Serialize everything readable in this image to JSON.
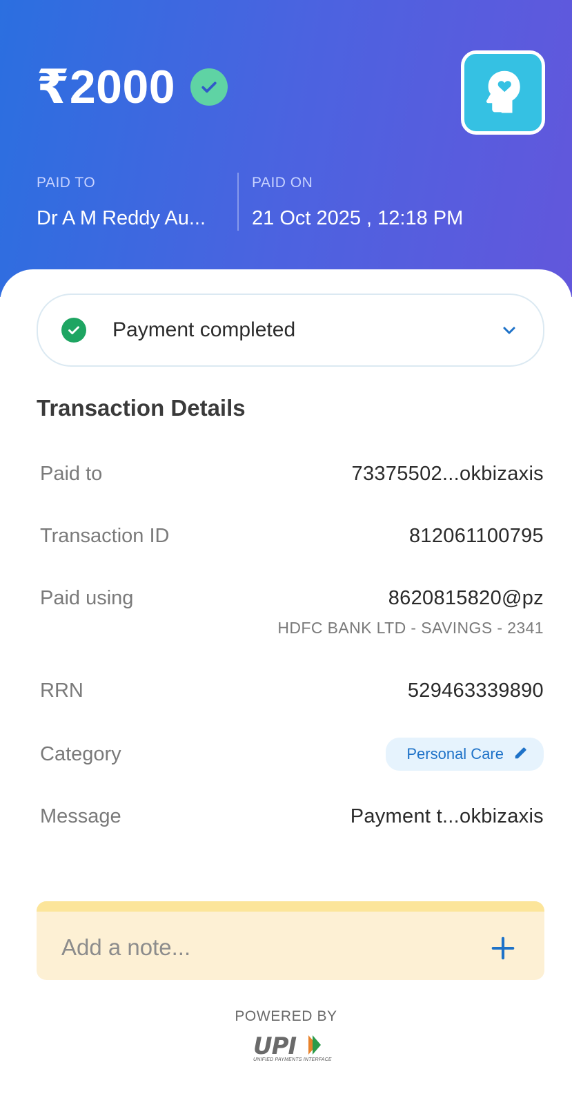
{
  "header": {
    "amount": "₹2000",
    "paid_to_label": "PAID TO",
    "paid_to_value": "Dr A M Reddy Au...",
    "paid_on_label": "PAID ON",
    "paid_on_value": "21 Oct 2025 , 12:18 PM"
  },
  "status": {
    "text": "Payment completed"
  },
  "transaction": {
    "title": "Transaction Details",
    "rows": [
      {
        "label": "Paid to",
        "value": "73375502...okbizaxis"
      },
      {
        "label": "Transaction ID",
        "value": "812061100795"
      },
      {
        "label": "Paid using",
        "value": "8620815820@pz",
        "sub": "HDFC BANK LTD - SAVINGS - 2341"
      },
      {
        "label": "RRN",
        "value": "529463339890"
      },
      {
        "label": "Category",
        "value": "Personal Care"
      },
      {
        "label": "Message",
        "value": "Payment t...okbizaxis"
      }
    ]
  },
  "note": {
    "placeholder": "Add a note..."
  },
  "footer": {
    "powered_by": "POWERED BY",
    "brand": "UPI",
    "brand_sub": "UNIFIED PAYMENTS INTERFACE"
  },
  "colors": {
    "header_start": "#2b6fe0",
    "header_end": "#6257dc",
    "success_green": "#1ea562",
    "accent_blue": "#1e72c8",
    "note_bg": "#fdf0d4",
    "logo_bg": "#35c1e3"
  },
  "icons": {
    "verified": "verified-check-icon",
    "merchant": "head-heart-icon",
    "status": "check-circle-icon",
    "expand": "chevron-down-icon",
    "edit": "pencil-icon",
    "add": "plus-icon"
  }
}
